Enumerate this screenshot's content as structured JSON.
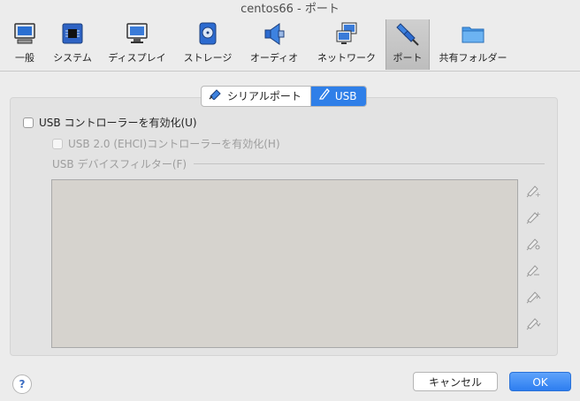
{
  "window": {
    "title": "centos66 - ポート"
  },
  "toolbar": {
    "items": [
      {
        "label": "一般",
        "icon": "monitor-icon"
      },
      {
        "label": "システム",
        "icon": "chip-icon"
      },
      {
        "label": "ディスプレイ",
        "icon": "display-icon"
      },
      {
        "label": "ストレージ",
        "icon": "disk-icon"
      },
      {
        "label": "オーディオ",
        "icon": "speaker-icon"
      },
      {
        "label": "ネットワーク",
        "icon": "network-icon"
      },
      {
        "label": "ポート",
        "icon": "plug-icon"
      },
      {
        "label": "共有フォルダー",
        "icon": "folder-icon"
      }
    ],
    "selected": "ポート"
  },
  "tabs": [
    {
      "label": "シリアルポート",
      "selected": false
    },
    {
      "label": "USB",
      "selected": true
    }
  ],
  "usb": {
    "enable_label": "USB コントローラーを有効化(U)",
    "enable_checked": false,
    "ehci_label": "USB 2.0 (EHCI)コントローラーを有効化(H)",
    "ehci_checked": false,
    "ehci_enabled": false,
    "filters_label": "USB デバイスフィルター(F)",
    "filters": [],
    "filter_buttons": [
      "add-empty-filter-icon",
      "add-device-filter-icon",
      "edit-filter-icon",
      "remove-filter-icon",
      "move-up-filter-icon",
      "move-down-filter-icon"
    ]
  },
  "footer": {
    "help": "?",
    "cancel": "キャンセル",
    "ok": "OK"
  },
  "colors": {
    "accent": "#2f7fe8",
    "window_bg": "#ececec",
    "filter_list_bg": "#d6d3ce"
  }
}
